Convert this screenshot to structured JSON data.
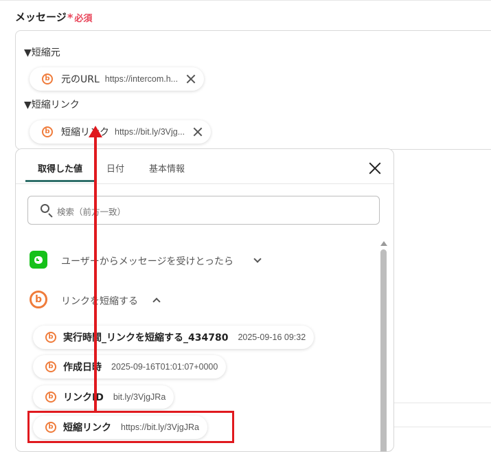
{
  "field": {
    "label": "メッセージ",
    "required": "必須"
  },
  "message": {
    "line1": "▼短縮元",
    "chip1": {
      "name": "元のURL",
      "value": "https://intercom.h..."
    },
    "line2": "▼短縮リンク",
    "chip2": {
      "name": "短縮リンク",
      "value": "https://bit.ly/3Vjg..."
    }
  },
  "panel": {
    "tabs": [
      "取得した値",
      "日付",
      "基本情報"
    ],
    "search_placeholder": "検索（前方一致）",
    "section1_title": "ユーザーからメッセージを受けとったら",
    "section2_title": "リンクを短縮する",
    "outputs": [
      {
        "name": "実行時間_リンクを短縮する_434780",
        "value": "2025-09-16 09:32"
      },
      {
        "name": "作成日時",
        "value": "2025-09-16T01:01:07+0000"
      },
      {
        "name": "リンクID",
        "value": "bit.ly/3VjgJRa"
      },
      {
        "name": "短縮リンク",
        "value": "https://bit.ly/3VjgJRa"
      }
    ]
  },
  "colors": {
    "required": "#e8455a",
    "accent": "#2f6f6a",
    "bitly": "#ef7b3a",
    "line": "#16c11a",
    "annotation": "#e0191e"
  },
  "icons": {
    "bitly": "b"
  }
}
